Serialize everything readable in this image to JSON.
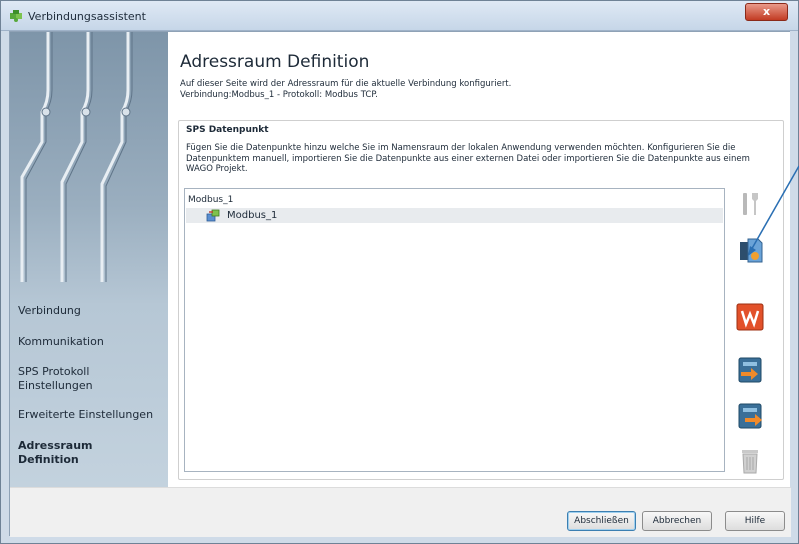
{
  "window": {
    "title": "Verbindungsassistent",
    "close_symbol": "x"
  },
  "sidebar": {
    "items": [
      {
        "label": "Verbindung",
        "active": false
      },
      {
        "label": "Kommunikation",
        "active": false
      },
      {
        "label": "SPS Protokoll Einstellungen",
        "active": false
      },
      {
        "label": "Erweiterte Einstellungen",
        "active": false
      },
      {
        "label": "Adressraum Definition",
        "active": true
      }
    ]
  },
  "main": {
    "title": "Adressraum Definition",
    "desc_line1": "Auf dieser Seite wird der Adressraum für die aktuelle Verbindung konfiguriert.",
    "desc_line2": "Verbindung:Modbus_1 - Protokoll: Modbus TCP."
  },
  "group": {
    "title": "SPS Datenpunkt",
    "description": "Fügen Sie die Datenpunkte hinzu welche Sie im Namensraum der lokalen Anwendung verwenden möchten. Konfigurieren Sie die Datenpunktem manuell, importieren Sie die Datenpunkte aus einer externen Datei oder importieren Sie die Datenpunkte aus einem WAGO Projekt."
  },
  "tree": {
    "root_label": "Modbus_1",
    "children": [
      {
        "label": "Modbus_1",
        "icon": "network-node-icon",
        "selected": true
      }
    ]
  },
  "toolbar": [
    {
      "name": "configure-tools-icon",
      "enabled": false
    },
    {
      "name": "add-datapoint-icon",
      "enabled": true
    },
    {
      "name": "wago-project-icon",
      "enabled": true
    },
    {
      "name": "import-file-icon",
      "enabled": true
    },
    {
      "name": "export-file-icon",
      "enabled": true
    },
    {
      "name": "delete-trash-icon",
      "enabled": false
    }
  ],
  "footer": {
    "finish_label": "Abschließen",
    "cancel_label": "Abbrechen",
    "help_label": "Hilfe"
  },
  "colors": {
    "sidebar_top": "#7e95a9",
    "sidebar_bottom": "#c3d2de",
    "close_button": "#c23b23",
    "annotation_arrow": "#2a6fb3"
  }
}
